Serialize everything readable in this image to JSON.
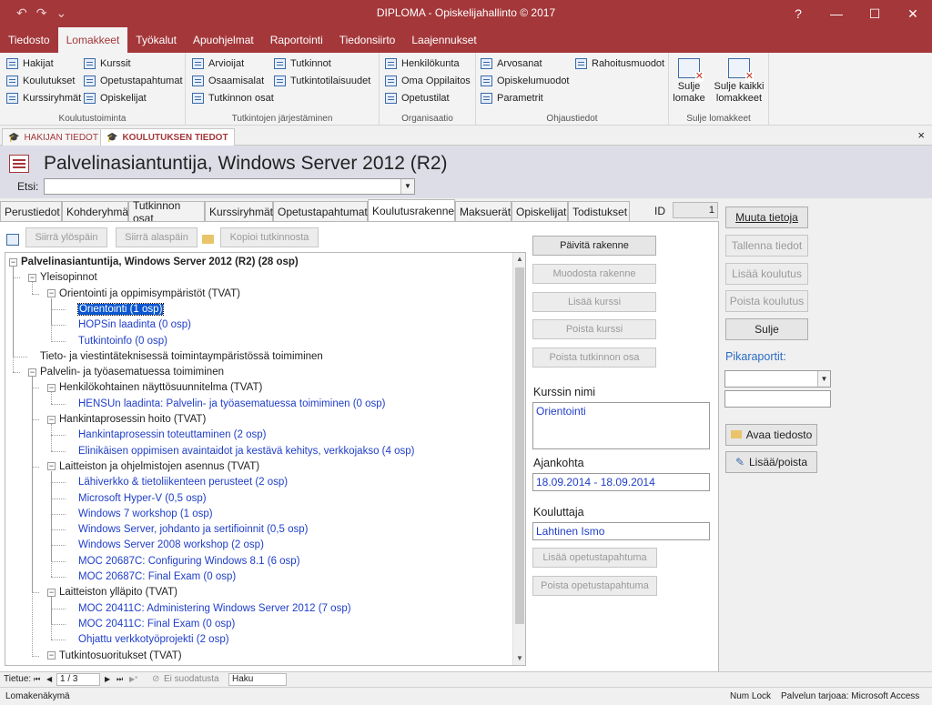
{
  "window": {
    "title": "DIPLOMA - Opiskelijahallinto © 2017",
    "help": "?",
    "minimize": "—",
    "maximize": "☐",
    "close": "✕"
  },
  "quick_access": {
    "undo": "↶",
    "redo": "↷",
    "customize": "⌄"
  },
  "menu": [
    "Tiedosto",
    "Lomakkeet",
    "Työkalut",
    "Apuohjelmat",
    "Raportointi",
    "Tiedonsiirto",
    "Laajennukset"
  ],
  "menu_active_index": 1,
  "ribbon": {
    "koulutustoiminta": {
      "label": "Koulutustoiminta",
      "col1": [
        "Hakijat",
        "Koulutukset",
        "Kurssiryhmät"
      ],
      "col2": [
        "Kurssit",
        "Opetustapahtumat",
        "Opiskelijat"
      ]
    },
    "tutkintojen": {
      "label": "Tutkintojen järjestäminen",
      "col1": [
        "Arvioijat",
        "Osaamisalat",
        "Tutkinnon osat"
      ],
      "col2": [
        "Tutkinnot",
        "Tutkintotilaisuudet"
      ]
    },
    "organisaatio": {
      "label": "Organisaatio",
      "col1": [
        "Henkilökunta",
        "Oma Oppilaitos",
        "Opetustilat"
      ]
    },
    "ohjaustiedot": {
      "label": "Ohjaustiedot",
      "col1": [
        "Arvosanat",
        "Opiskelumuodot",
        "Parametrit"
      ],
      "col2": [
        "Rahoitusmuodot"
      ]
    },
    "sulje": {
      "label": "Sulje lomakkeet",
      "btn1": [
        "Sulje",
        "lomake"
      ],
      "btn2": [
        "Sulje kaikki",
        "lomakkeet"
      ]
    }
  },
  "doc_tabs": [
    {
      "label": "HAKIJAN TIEDOT",
      "active": false
    },
    {
      "label": "KOULUTUKSEN TIEDOT",
      "active": true
    }
  ],
  "doc_close": "×",
  "form": {
    "title": "Palvelinasiantuntija, Windows Server 2012 (R2)",
    "search_label": "Etsi:",
    "search_value": "",
    "tabs": [
      "Perustiedot",
      "Kohderyhmä",
      "Tutkinnon osat",
      "Kurssiryhmät",
      "Opetustapahtumat",
      "Koulutusrakenne",
      "Maksuerät",
      "Opiskelijat",
      "Todistukset"
    ],
    "active_tab_index": 5,
    "id_label": "ID",
    "id_value": "1"
  },
  "toolbar": {
    "move_up": "Siirrä ylöspäin",
    "move_down": "Siirrä alaspäin",
    "copy": "Kopioi tutkinnosta"
  },
  "tree": [
    {
      "level": 0,
      "text": "Palvelinasiantuntija, Windows Server 2012 (R2) (28 osp)",
      "bold": true,
      "box": "−"
    },
    {
      "level": 1,
      "text": "Yleisopinnot",
      "box": "−"
    },
    {
      "level": 2,
      "text": "Orientointi ja oppimisympäristöt (TVAT)",
      "box": "−"
    },
    {
      "level": 3,
      "text": "Orientointi (1 osp)",
      "course": true,
      "selected": true
    },
    {
      "level": 3,
      "text": "HOPSin laadinta (0 osp)",
      "course": true
    },
    {
      "level": 3,
      "text": "Tutkintoinfo (0 osp)",
      "course": true
    },
    {
      "level": 1,
      "text": "Tieto- ja viestintäteknisessä toimintaympäristössä toimiminen"
    },
    {
      "level": 1,
      "text": "Palvelin- ja työasematuessa toimiminen",
      "box": "−"
    },
    {
      "level": 2,
      "text": "Henkilökohtainen näyttösuunnitelma (TVAT)",
      "box": "−"
    },
    {
      "level": 3,
      "text": "HENSUn laadinta: Palvelin- ja työasematuessa toimiminen (0 osp)",
      "course": true
    },
    {
      "level": 2,
      "text": "Hankintaprosessin hoito (TVAT)",
      "box": "−"
    },
    {
      "level": 3,
      "text": "Hankintaprosessin toteuttaminen (2 osp)",
      "course": true
    },
    {
      "level": 3,
      "text": "Elinikäisen oppimisen avaintaidot ja kestävä kehitys, verkkojakso (4 osp)",
      "course": true
    },
    {
      "level": 2,
      "text": "Laitteiston ja ohjelmistojen asennus (TVAT)",
      "box": "−"
    },
    {
      "level": 3,
      "text": "Lähiverkko & tietoliikenteen perusteet (2 osp)",
      "course": true
    },
    {
      "level": 3,
      "text": "Microsoft Hyper-V (0,5 osp)",
      "course": true
    },
    {
      "level": 3,
      "text": "Windows 7 workshop (1 osp)",
      "course": true
    },
    {
      "level": 3,
      "text": "Windows Server, johdanto ja sertifioinnit (0,5 osp)",
      "course": true
    },
    {
      "level": 3,
      "text": "Windows Server 2008 workshop (2 osp)",
      "course": true
    },
    {
      "level": 3,
      "text": "MOC 20687C: Configuring Windows 8.1 (6 osp)",
      "course": true
    },
    {
      "level": 3,
      "text": "MOC 20687C: Final Exam (0 osp)",
      "course": true
    },
    {
      "level": 2,
      "text": "Laitteiston ylläpito (TVAT)",
      "box": "−"
    },
    {
      "level": 3,
      "text": "MOC 20411C: Administering Windows Server 2012 (7 osp)",
      "course": true
    },
    {
      "level": 3,
      "text": "MOC 20411C: Final Exam (0 osp)",
      "course": true
    },
    {
      "level": 3,
      "text": "Ohjattu verkkotyöprojekti (2 osp)",
      "course": true
    },
    {
      "level": 2,
      "text": "Tutkintosuoritukset (TVAT)",
      "box": "−"
    }
  ],
  "actions": {
    "update": "Päivitä rakenne",
    "build": "Muodosta rakenne",
    "add_course": "Lisää kurssi",
    "remove_course": "Poista kurssi",
    "remove_part": "Poista tutkinnon osa"
  },
  "details": {
    "course_label": "Kurssin nimi",
    "course_value": "Orientointi",
    "time_label": "Ajankohta",
    "time_value": "18.09.2014 - 18.09.2014",
    "trainer_label": "Kouluttaja",
    "trainer_value": "Lahtinen Ismo",
    "add_event": "Lisää opetustapahtuma",
    "remove_event": "Poista opetustapahtuma"
  },
  "side": {
    "edit": "Muuta tietoja",
    "save": "Tallenna tiedot",
    "add_training": "Lisää koulutus",
    "remove_training": "Poista koulutus",
    "close": "Sulje",
    "reports_label": "Pikaraportit:",
    "open_file": "Avaa tiedosto",
    "add_remove": "Lisää/poista"
  },
  "navigator": {
    "label": "Tietue:",
    "first": "⏮",
    "prev": "◀",
    "position": "1 / 3",
    "next": "▶",
    "last": "⏭",
    "new": "▶*",
    "filter": "Ei suodatusta",
    "search": "Haku"
  },
  "status": {
    "left": "Lomakenäkymä",
    "numlock": "Num Lock",
    "provider": "Palvelun tarjoaa: Microsoft Access"
  }
}
